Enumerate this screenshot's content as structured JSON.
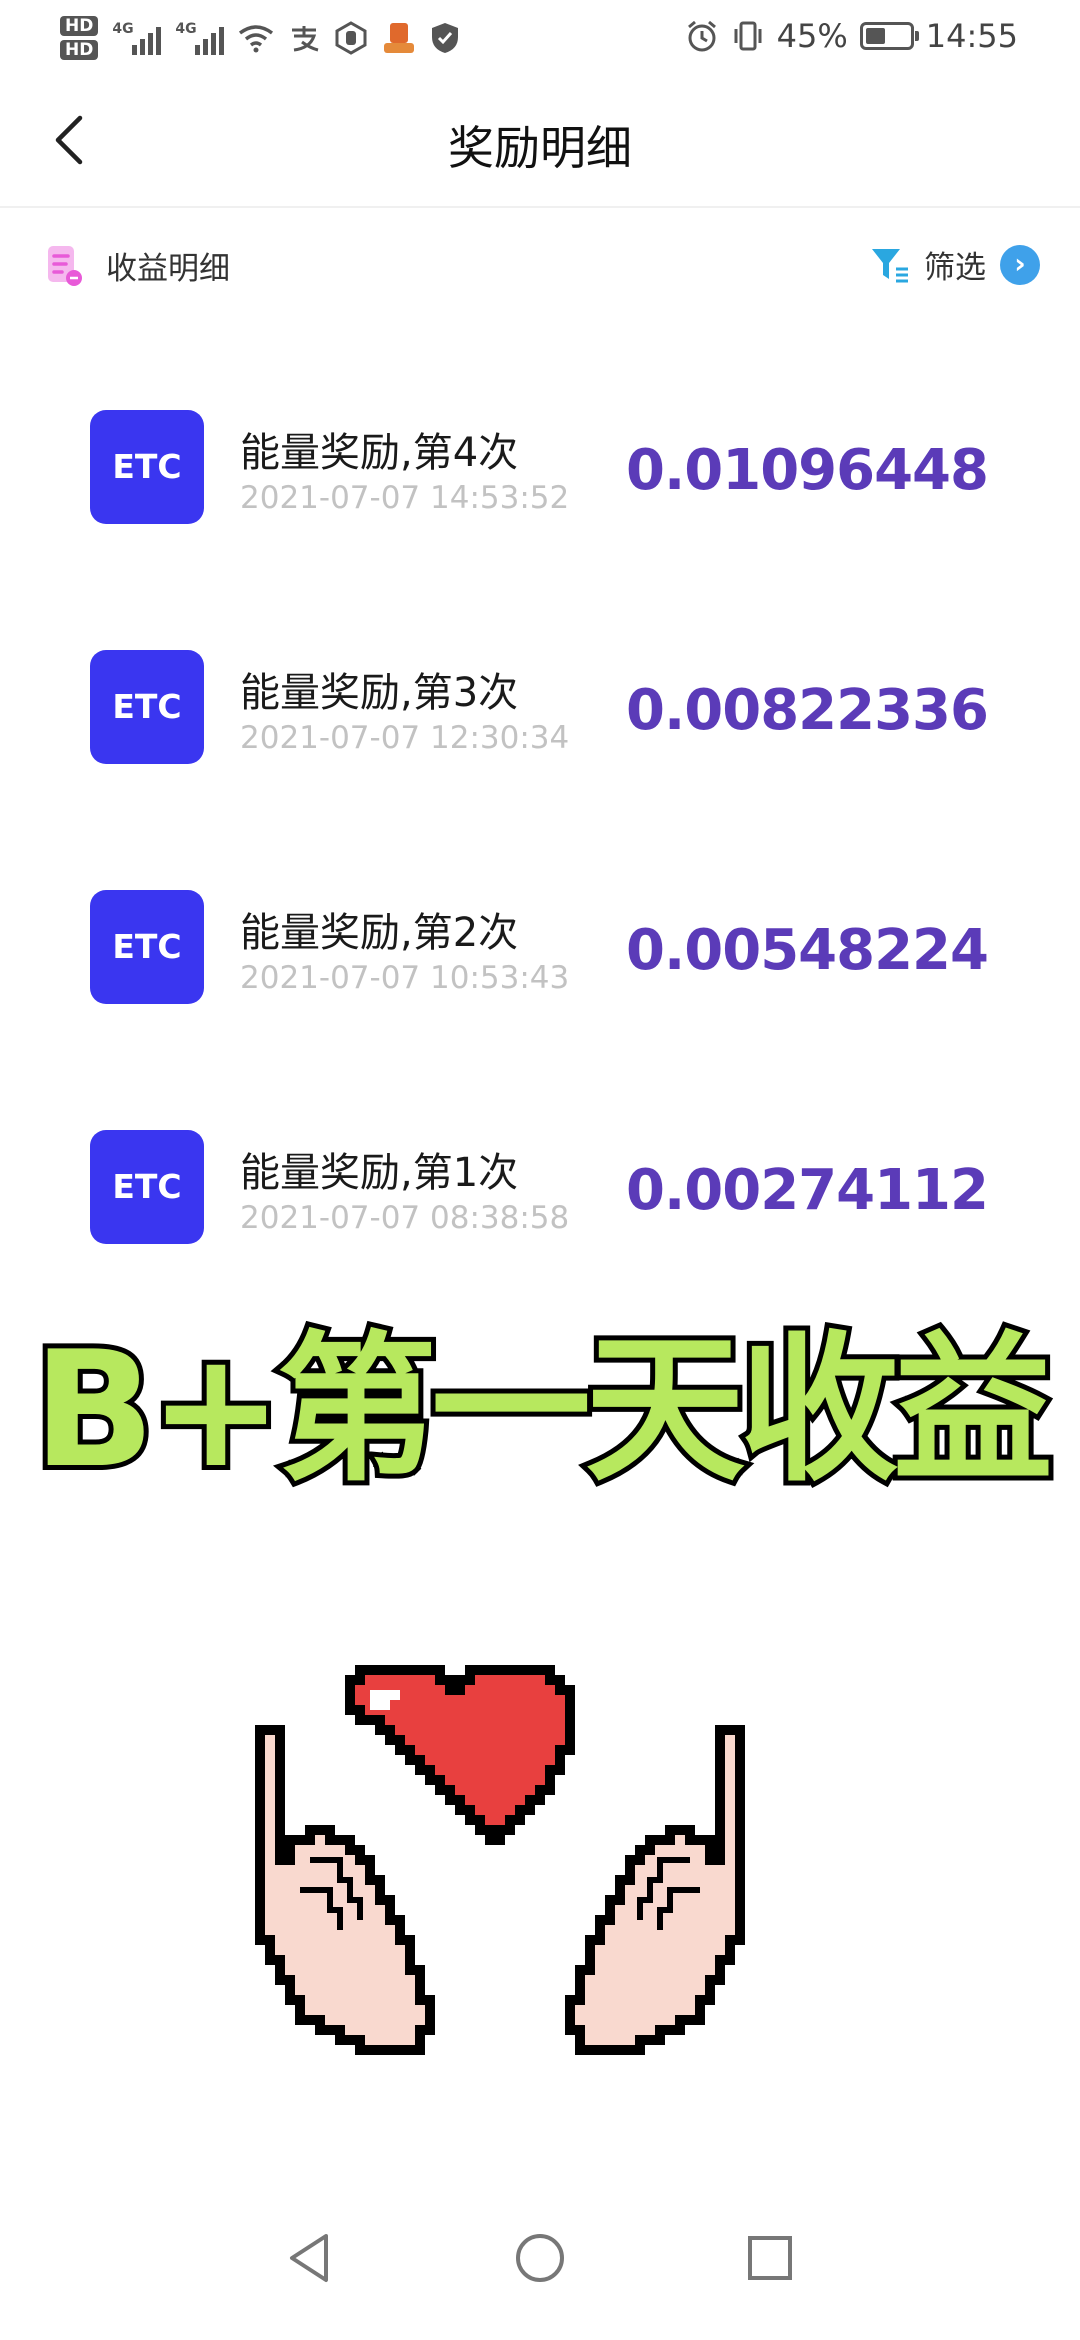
{
  "status_bar": {
    "hd1": "HD",
    "hd2": "HD",
    "net1": "4G",
    "net2": "4G",
    "battery_percent": "45%",
    "battery_level": 0.45,
    "time": "14:55"
  },
  "header": {
    "title": "奖励明细"
  },
  "subbar": {
    "left_label": "收益明细",
    "right_label": "筛选"
  },
  "records": [
    {
      "coin": "ETC",
      "title": "能量奖励,第4次",
      "time": "2021-07-07 14:53:52",
      "amount": "0.01096448"
    },
    {
      "coin": "ETC",
      "title": "能量奖励,第3次",
      "time": "2021-07-07 12:30:34",
      "amount": "0.00822336"
    },
    {
      "coin": "ETC",
      "title": "能量奖励,第2次",
      "time": "2021-07-07 10:53:43",
      "amount": "0.00548224"
    },
    {
      "coin": "ETC",
      "title": "能量奖励,第1次",
      "time": "2021-07-07 08:38:58",
      "amount": "0.00274112"
    }
  ],
  "caption": "B+第一天收益",
  "colors": {
    "coin_bg": "#3a36f0",
    "amount": "#5b3bb8",
    "caption_fill": "#b7e85e",
    "filter_icon": "#2aa7e0",
    "arrow_circle": "#3fa1ea",
    "doc_icon": "#e85ad8"
  },
  "icons": [
    "back-arrow-icon",
    "document-icon",
    "filter-icon",
    "chevron-right-icon",
    "heart-hands-icon",
    "nav-back-icon",
    "nav-home-icon",
    "nav-recents-icon"
  ]
}
